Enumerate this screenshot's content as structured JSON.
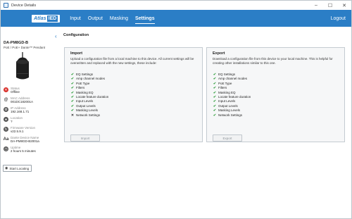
{
  "window": {
    "title": "Device Details",
    "controls": [
      "–",
      "☐",
      "✕"
    ]
  },
  "nav": {
    "logo_atlas": "Atlas",
    "logo_ied": "IED",
    "links": [
      "Input",
      "Output",
      "Masking",
      "Settings"
    ],
    "active": "Settings",
    "logout": "Logout"
  },
  "device": {
    "name": "DA-PM8GD-B",
    "model": "PoE / PoE+ Dante™ Pendant",
    "info": [
      {
        "label": "Status",
        "value": "Offline",
        "icon": "status-alert-icon"
      },
      {
        "label": "MAC Address",
        "value": "001DC182001A",
        "icon": "mac-icon"
      },
      {
        "label": "IP Address",
        "value": "192.168.1.71",
        "icon": "ip-icon"
      },
      {
        "label": "Location",
        "value": "?",
        "icon": "location-icon"
      },
      {
        "label": "Firmware Version",
        "value": "v22.5.9.1",
        "icon": "firmware-icon"
      },
      {
        "label": "Dante Device Name",
        "value": "DA-PM8GD-B2001a",
        "icon": "dante-icon"
      },
      {
        "label": "Uptime",
        "value": "2 hours 5 minutes",
        "icon": "uptime-icon"
      }
    ],
    "locate_button": "Start Locating"
  },
  "page": {
    "title": "Configuration"
  },
  "import": {
    "title": "Import",
    "description": "Upload a configuration file from a local machine to this device. All current settings will be overwritten and replaced with the new settings, these include:",
    "items": [
      {
        "label": "EQ Settings",
        "included": true
      },
      {
        "label": "Amp channel modes",
        "included": true
      },
      {
        "label": "PoE Type",
        "included": true
      },
      {
        "label": "Filters",
        "included": true
      },
      {
        "label": "Masking EQ",
        "included": true
      },
      {
        "label": "Locate feature duration",
        "included": true
      },
      {
        "label": "Input Levels",
        "included": true
      },
      {
        "label": "Output Levels",
        "included": true
      },
      {
        "label": "Masking Levels",
        "included": true
      },
      {
        "label": "Network Settings",
        "included": false
      }
    ],
    "button": "Import"
  },
  "export": {
    "title": "Export",
    "description": "Download a configuration file from this device to your local machine. This is helpful for creating other installations similar to this one.",
    "items": [
      {
        "label": "EQ Settings",
        "included": true
      },
      {
        "label": "Amp channel modes",
        "included": true
      },
      {
        "label": "PoE Type",
        "included": true
      },
      {
        "label": "Filters",
        "included": true
      },
      {
        "label": "Masking EQ",
        "included": true
      },
      {
        "label": "Locate feature duration",
        "included": true
      },
      {
        "label": "Input Levels",
        "included": true
      },
      {
        "label": "Output Levels",
        "included": true
      },
      {
        "label": "Masking Levels",
        "included": true
      },
      {
        "label": "Network Settings",
        "included": true
      }
    ],
    "button": "Export"
  },
  "colors": {
    "brand": "#2b7ec6",
    "check": "#2e9e3b",
    "alert": "#d9312c"
  }
}
